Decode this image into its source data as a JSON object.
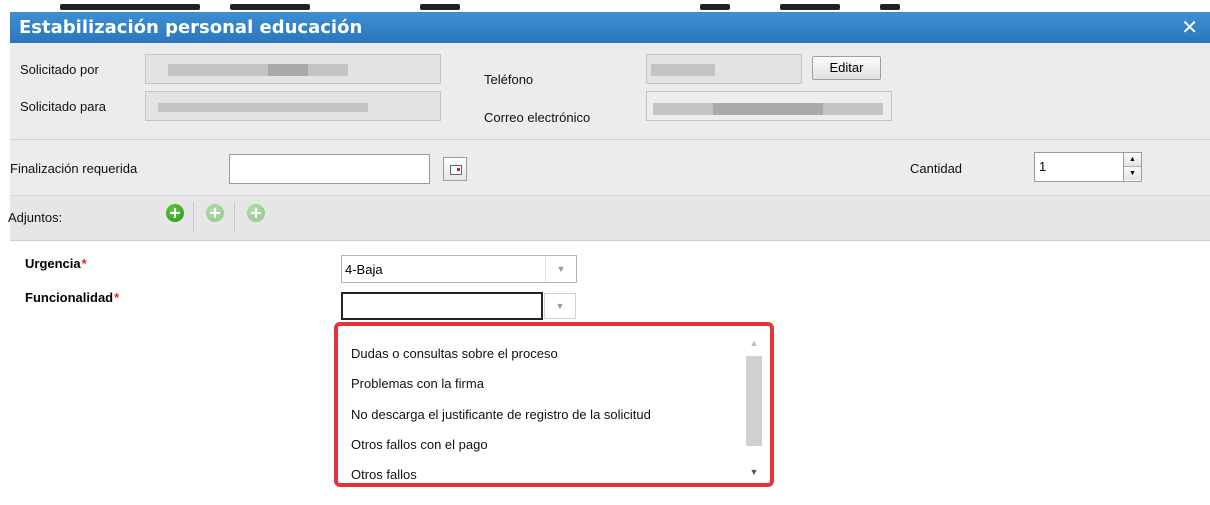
{
  "dialog": {
    "title": "Estabilización personal educación",
    "close_label": "✕"
  },
  "requester": {
    "solicitado_por_label": "Solicitado por",
    "solicitado_para_label": "Solicitado para",
    "telefono_label": "Teléfono",
    "correo_label": "Correo electrónico",
    "editar_label": "Editar"
  },
  "finalizacion": {
    "label": "Finalización requerida",
    "value": "",
    "cantidad_label": "Cantidad",
    "cantidad_value": "1"
  },
  "adjuntos": {
    "label": "Adjuntos:"
  },
  "form": {
    "urgencia_label": "Urgencia",
    "urgencia_value": "4-Baja",
    "funcionalidad_label": "Funcionalidad",
    "funcionalidad_value": "",
    "required_mark": "*"
  },
  "dropdown": {
    "options": [
      "Dudas o consultas sobre el proceso",
      "Problemas con la firma",
      "No descarga el justificante de registro de la solicitud",
      "Otros fallos con el pago",
      "Otros fallos"
    ]
  },
  "icons": {
    "add": "plus-circle-icon",
    "calendar": "calendar-icon",
    "spin_up": "▲",
    "spin_down": "▼",
    "combo_arrow": "▼",
    "scroll_up": "▲",
    "scroll_down": "▼"
  },
  "colors": {
    "titlebar": "#2a76bf",
    "highlight_border": "#e8323a",
    "required": "#e0262a"
  }
}
